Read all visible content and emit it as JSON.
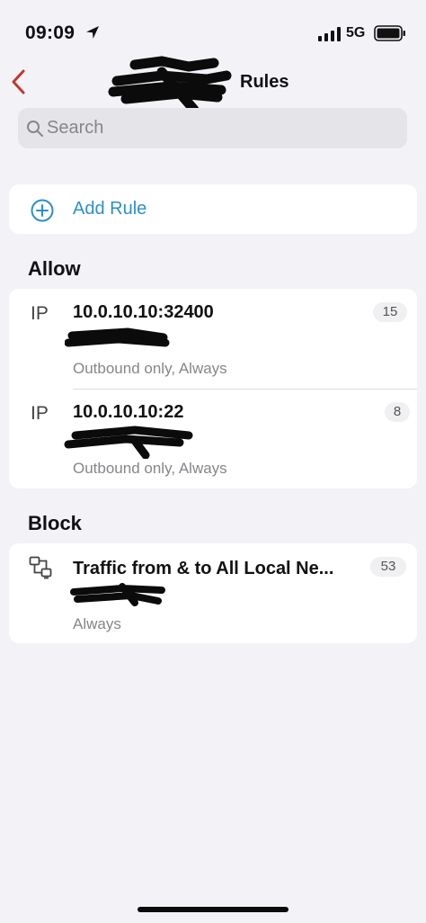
{
  "status_bar": {
    "time": "09:09",
    "network": "5G"
  },
  "nav": {
    "title": "Rules"
  },
  "search": {
    "placeholder": "Search"
  },
  "add_rule": {
    "label": "Add Rule"
  },
  "sections": {
    "allow": {
      "header": "Allow",
      "rows": [
        {
          "type": "IP",
          "title": "10.0.10.10:32400",
          "subtitle": "Outbound only, Always",
          "count": "15"
        },
        {
          "type": "IP",
          "title": "10.0.10.10:22",
          "subtitle": "Outbound only, Always",
          "count": "8"
        }
      ]
    },
    "block": {
      "header": "Block",
      "rows": [
        {
          "title": "Traffic from & to All Local Ne...",
          "subtitle": "Always",
          "count": "53"
        }
      ]
    }
  },
  "colors": {
    "accent": "#2d8fc8",
    "back": "#c0392b",
    "background": "#f2f2f7"
  }
}
